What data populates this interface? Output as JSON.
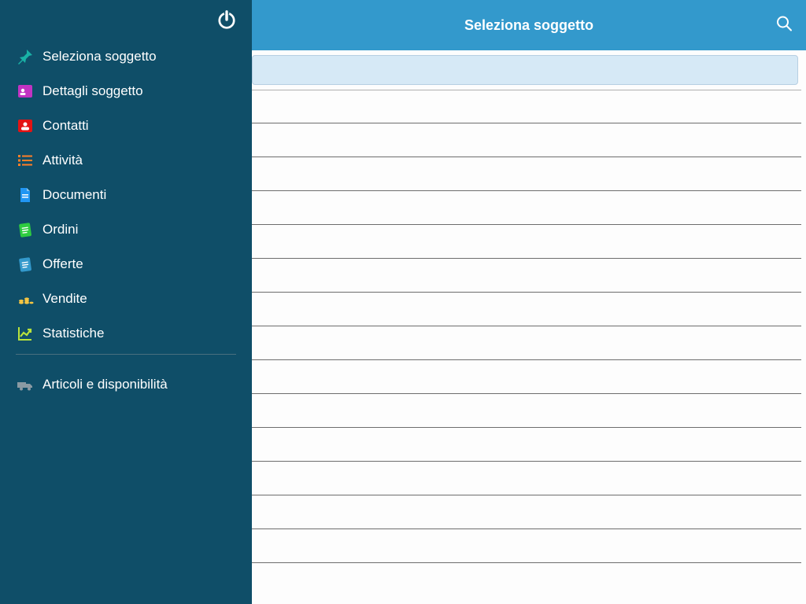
{
  "header": {
    "title": "Seleziona soggetto"
  },
  "sidebar": {
    "items": [
      {
        "label": "Seleziona soggetto",
        "icon": "pin-icon",
        "color": "#19b2a6"
      },
      {
        "label": "Dettagli soggetto",
        "icon": "id-icon",
        "color": "#c233c2"
      },
      {
        "label": "Contatti",
        "icon": "contacts-icon",
        "color": "#e31414"
      },
      {
        "label": "Attività",
        "icon": "list-icon",
        "color": "#ff7f27"
      },
      {
        "label": "Documenti",
        "icon": "document-icon",
        "color": "#2196f3"
      },
      {
        "label": "Ordini",
        "icon": "clipboard-icon",
        "color": "#2ecc40"
      },
      {
        "label": "Offerte",
        "icon": "clipboard-icon",
        "color": "#3399cc"
      },
      {
        "label": "Vendite",
        "icon": "coins-icon",
        "color": "#f5c542"
      },
      {
        "label": "Statistiche",
        "icon": "chart-icon",
        "color": "#b8e23c"
      }
    ],
    "secondary": [
      {
        "label": "Articoli e disponibilità",
        "icon": "truck-icon",
        "color": "#8a9aa3"
      }
    ]
  },
  "list": {
    "row_count": 14
  }
}
